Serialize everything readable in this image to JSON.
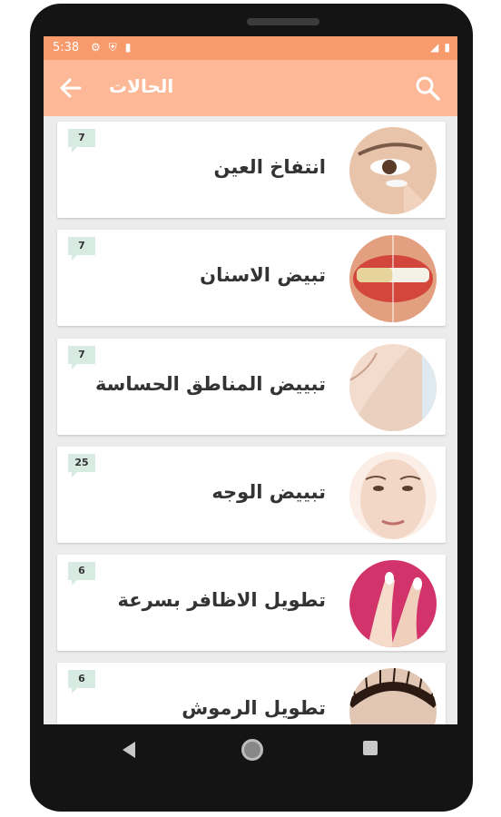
{
  "status_bar": {
    "time": "5:38"
  },
  "app_bar": {
    "title": "الحالات"
  },
  "items": [
    {
      "title": "انتفاخ العين",
      "count": "7"
    },
    {
      "title": "تبيض الاسنان",
      "count": "7"
    },
    {
      "title": "تبييض المناطق الحساسة",
      "count": "7"
    },
    {
      "title": "تبييض الوجه",
      "count": "25"
    },
    {
      "title": "تطويل الاظافر بسرعة",
      "count": "6"
    },
    {
      "title": "تطويل الرموش",
      "count": "6"
    }
  ],
  "colors": {
    "status_bar": "#f79a6c",
    "app_bar": "#fdb997",
    "badge": "#d8ebe3"
  }
}
